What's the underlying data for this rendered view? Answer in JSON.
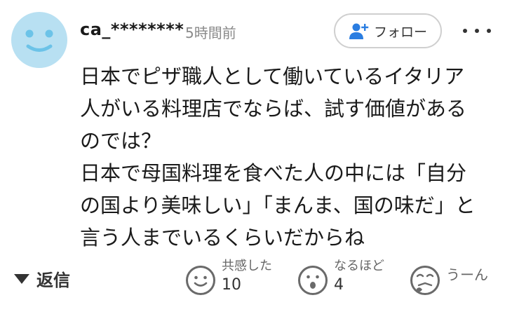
{
  "comment": {
    "username": "ca_********",
    "timestamp": "5時間前",
    "follow_label": "フォロー",
    "lines": [
      "日本でピザ職人として働いているイタリア",
      "人がいる料理店でならば、試す価値がある",
      "のでは？",
      "日本で母国料理を食べた人の中には「自分",
      "の国より美味しい」「まんま、国の味だ」と",
      "言う人までいるくらいだからね"
    ]
  },
  "actions": {
    "reply_label": "返信",
    "reactions": [
      {
        "label": "共感した",
        "count": "10",
        "icon": "smile-face-icon"
      },
      {
        "label": "なるほど",
        "count": "4",
        "icon": "surprised-face-icon"
      },
      {
        "label": "うーん",
        "count": "",
        "icon": "confused-face-icon"
      }
    ]
  },
  "colors": {
    "avatar_bg": "#b8e0f2",
    "follow_icon": "#2a7de1",
    "icon_stroke": "#6a6a6a"
  }
}
